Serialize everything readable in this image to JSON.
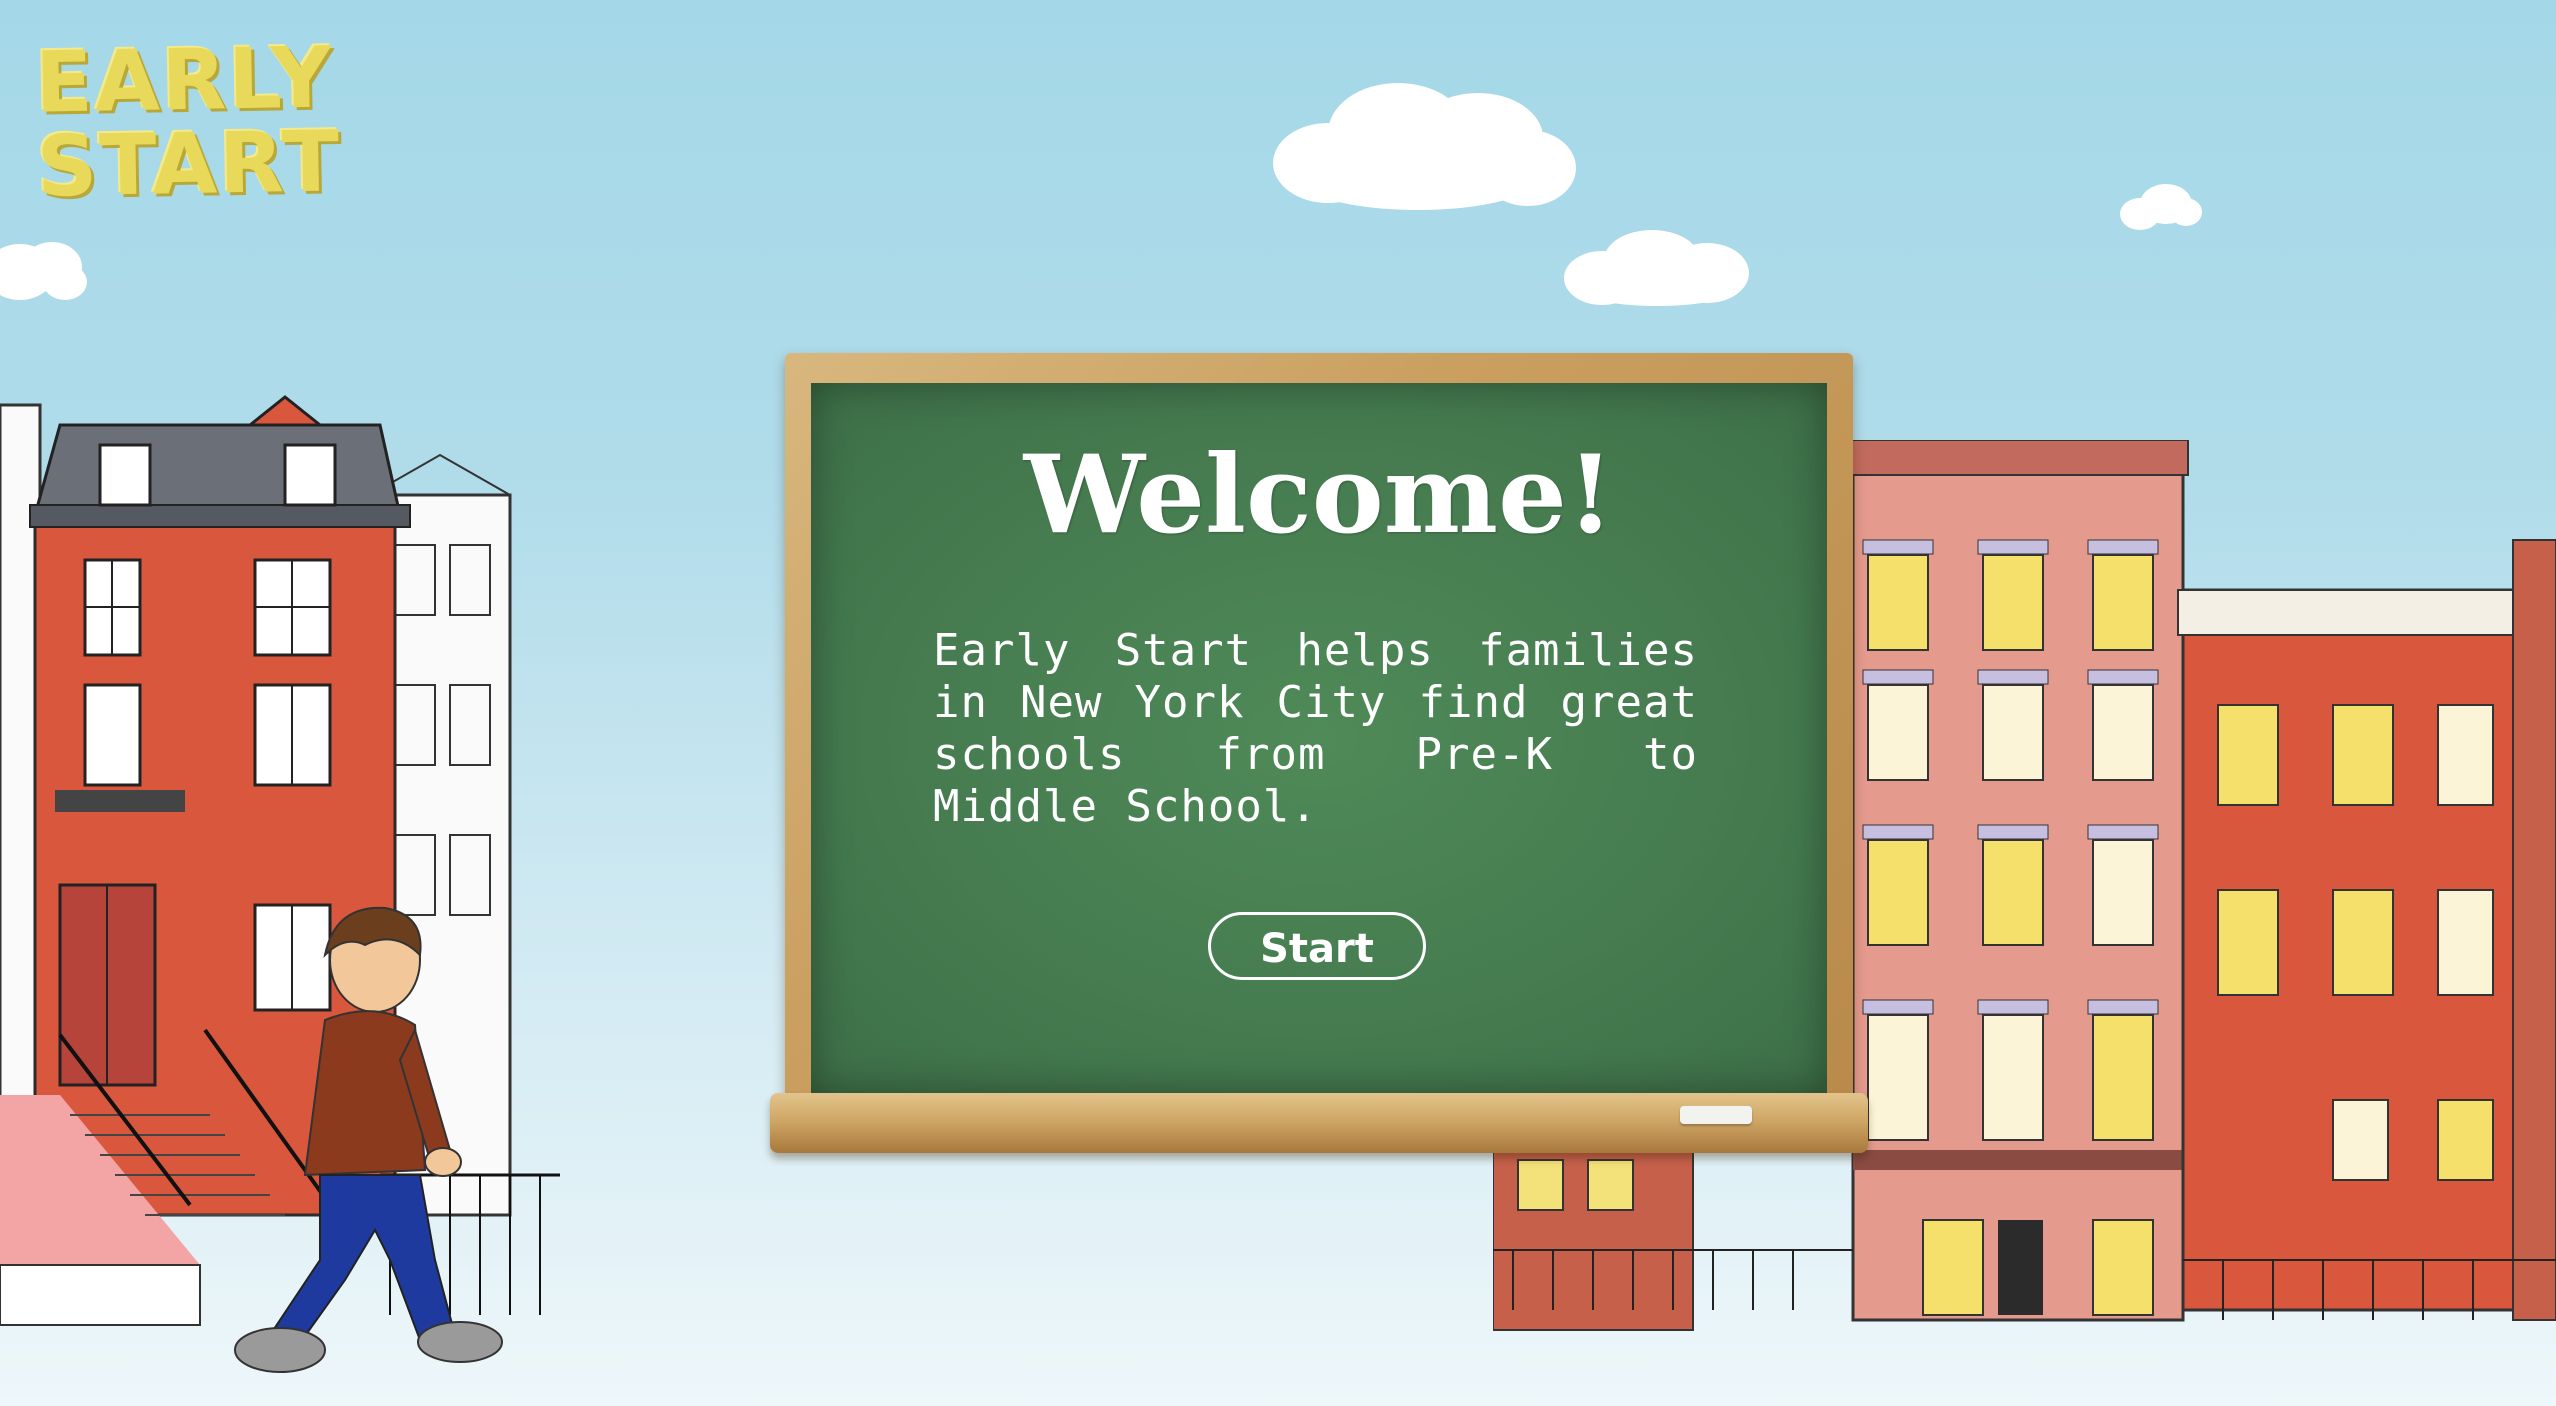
{
  "logo": {
    "line1": "EARLY",
    "line2": "START",
    "color": "#e8d95a"
  },
  "board": {
    "title": "Welcome!",
    "description": "Early Start helps families in New York City find great schools from Pre-K to Middle School.",
    "start_label": "Start",
    "board_color": "#467c50",
    "frame_color": "#c99e5e"
  },
  "scene": {
    "sky_color": "#a4d8e8",
    "icons": [
      "cloud-icon",
      "townhouse-illustration",
      "brownstone-row-illustration",
      "walking-boy-illustration"
    ]
  }
}
